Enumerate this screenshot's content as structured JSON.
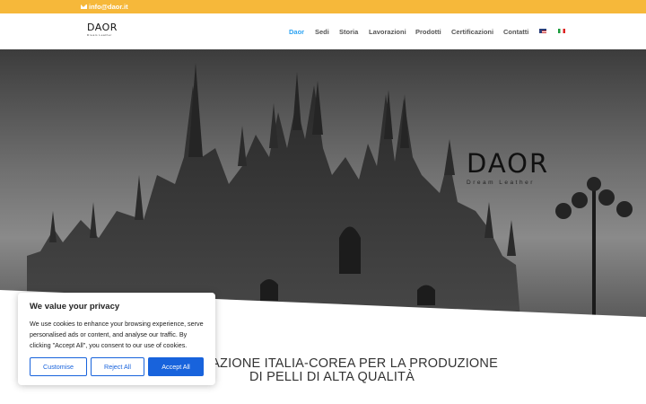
{
  "topbar": {
    "email": "info@daor.it",
    "icon": "mail-icon",
    "color": "#f6b83a"
  },
  "header": {
    "logo": {
      "main": "DAOR",
      "sub": "Dream Leather"
    },
    "nav": [
      {
        "label": "Daor",
        "active": true
      },
      {
        "label": "Sedi"
      },
      {
        "label": "Storia"
      },
      {
        "label": "Lavorazioni"
      },
      {
        "label": "Prodotti"
      },
      {
        "label": "Certificazioni"
      },
      {
        "label": "Contatti"
      }
    ],
    "languages": [
      "uk-flag-icon",
      "italy-flag-icon"
    ],
    "accent": "#2ea3f2"
  },
  "hero": {
    "brand": "DAOR",
    "tagline": "Dream Leather"
  },
  "section": {
    "title_line1": "LABORAZIONE ITALIA-COREA PER LA PRODUZIONE",
    "title_line2": "DI PELLI DI ALTA QUALITÀ"
  },
  "cookie": {
    "title": "We value your privacy",
    "text": "We use cookies to enhance your browsing experience, serve personalised ads or content, and analyse our traffic. By clicking \"Accept All\", you consent to our use of cookies.",
    "customise": "Customise",
    "reject": "Reject All",
    "accept": "Accept All",
    "button_color": "#1863dc"
  }
}
